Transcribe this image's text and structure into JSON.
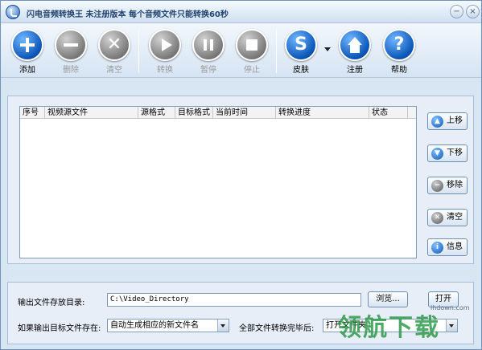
{
  "window": {
    "title": "闪电音频转换王  未注册版本 每个音频文件只能转换60秒",
    "minimize_glyph": "−",
    "close_glyph": "×"
  },
  "toolbar": {
    "add": "添加",
    "delete": "删除",
    "clear": "清空",
    "convert": "转换",
    "pause": "暂停",
    "stop": "停止",
    "skin": "皮肤",
    "register": "注册",
    "help": "帮助"
  },
  "list": {
    "columns": [
      "序号",
      "视频源文件",
      "源格式",
      "目标格式",
      "当前时间",
      "转换进度",
      "状态"
    ],
    "rows": []
  },
  "side_buttons": {
    "up": "上移",
    "down": "下移",
    "remove": "移除",
    "clear": "清空",
    "info": "信息"
  },
  "output": {
    "dir_label": "输出文件存放目录:",
    "dir_value": "C:\\Video_Directory",
    "browse": "浏览...",
    "open": "打开",
    "exists_label": "如果输出目标文件存在:",
    "exists_value": "自动生成相应的新文件名",
    "after_label": "全部文件转换完毕后:",
    "after_value": "打开文件夹"
  },
  "watermark": {
    "text": "领航下载",
    "url": "lhdown.com"
  },
  "colors": {
    "accent_blue": "#0b56b8",
    "disabled_gray": "#7a7a7a",
    "watermark_green": "#28964a"
  }
}
